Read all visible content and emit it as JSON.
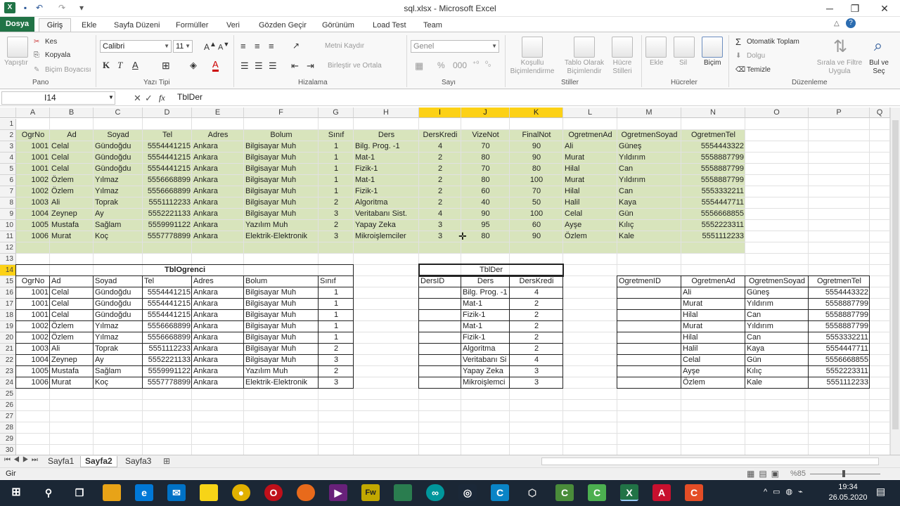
{
  "window": {
    "title": "sql.xlsx - Microsoft Excel",
    "minimize": "─",
    "restore": "❐",
    "close": "✕"
  },
  "tabs": {
    "file": "Dosya",
    "home": "Giriş",
    "items": [
      "Ekle",
      "Sayfa Düzeni",
      "Formüller",
      "Veri",
      "Gözden Geçir",
      "Görünüm",
      "Load Test",
      "Team"
    ]
  },
  "ribbon": {
    "clipboard": {
      "paste": "Yapıştır",
      "cut": "Kes",
      "copy": "Kopyala",
      "format_painter": "Biçim Boyacısı",
      "label": "Pano"
    },
    "font": {
      "name": "Calibri",
      "size": "11",
      "label": "Yazı Tipi",
      "bold": "K",
      "italic": "T",
      "underline": "A"
    },
    "alignment": {
      "wrap": "Metni Kaydır",
      "merge": "Birleştir ve Ortala",
      "label": "Hizalama"
    },
    "number": {
      "format": "Genel",
      "percent": "%",
      "label": "Sayı"
    },
    "styles": {
      "conditional": "Koşullu Biçimlendirme",
      "table": "Tablo Olarak Biçimlendir",
      "cell": "Hücre Stilleri",
      "label": "Stiller"
    },
    "cells": {
      "insert": "Ekle",
      "delete": "Sil",
      "format": "Biçim",
      "label": "Hücreler"
    },
    "editing": {
      "autosum": "Otomatik Toplam",
      "fill": "Dolgu",
      "clear": "Temizle",
      "sort": "Sırala ve Filtre Uygula",
      "find": "Bul ve Seç",
      "label": "Düzenleme"
    }
  },
  "formula_bar": {
    "name_box": "I14",
    "content": "TblDer",
    "fx": "fx"
  },
  "columns": [
    "A",
    "B",
    "C",
    "D",
    "E",
    "F",
    "G",
    "H",
    "I",
    "J",
    "K",
    "L",
    "M",
    "N",
    "O",
    "P",
    "Q"
  ],
  "rows": [
    "1",
    "2",
    "3",
    "4",
    "5",
    "6",
    "7",
    "8",
    "9",
    "10",
    "11",
    "12",
    "13",
    "14",
    "15",
    "16",
    "17",
    "18",
    "19",
    "20",
    "21",
    "22",
    "23",
    "24",
    "25",
    "26",
    "27",
    "28",
    "29",
    "30"
  ],
  "main_table": {
    "headers": [
      "OgrNo",
      "Ad",
      "Soyad",
      "Tel",
      "Adres",
      "Bolum",
      "Sınıf",
      "Ders",
      "DersKredi",
      "VizeNot",
      "FinalNot",
      "OgretmenAd",
      "OgretmenSoyad",
      "OgretmenTel"
    ],
    "rows": [
      [
        "1001",
        "Celal",
        "Gündoğdu",
        "5554441215",
        "Ankara",
        "Bilgisayar Muh",
        "1",
        "Bilg. Prog. -1",
        "4",
        "70",
        "90",
        "Ali",
        "Güneş",
        "5554443322"
      ],
      [
        "1001",
        "Celal",
        "Gündoğdu",
        "5554441215",
        "Ankara",
        "Bilgisayar Muh",
        "1",
        "Mat-1",
        "2",
        "80",
        "90",
        "Murat",
        "Yıldırım",
        "5558887799"
      ],
      [
        "1001",
        "Celal",
        "Gündoğdu",
        "5554441215",
        "Ankara",
        "Bilgisayar Muh",
        "1",
        "Fizik-1",
        "2",
        "70",
        "80",
        "Hilal",
        "Can",
        "5558887799"
      ],
      [
        "1002",
        "Özlem",
        "Yılmaz",
        "5556668899",
        "Ankara",
        "Bilgisayar Muh",
        "1",
        "Mat-1",
        "2",
        "80",
        "100",
        "Murat",
        "Yıldırım",
        "5558887799"
      ],
      [
        "1002",
        "Özlem",
        "Yılmaz",
        "5556668899",
        "Ankara",
        "Bilgisayar Muh",
        "1",
        "Fizik-1",
        "2",
        "60",
        "70",
        "Hilal",
        "Can",
        "5553332211"
      ],
      [
        "1003",
        "Ali",
        "Toprak",
        "5551112233",
        "Ankara",
        "Bilgisayar Muh",
        "2",
        "Algoritma",
        "2",
        "40",
        "50",
        "Halil",
        "Kaya",
        "5554447711"
      ],
      [
        "1004",
        "Zeynep",
        "Ay",
        "5552221133",
        "Ankara",
        "Bilgisayar Muh",
        "3",
        "Veritabanı Sist.",
        "4",
        "90",
        "100",
        "Celal",
        "Gün",
        "5556668855"
      ],
      [
        "1005",
        "Mustafa",
        "Sağlam",
        "5559991122",
        "Ankara",
        "Yazılım Muh",
        "2",
        "Yapay Zeka",
        "3",
        "95",
        "60",
        "Ayşe",
        "Kılıç",
        "5552223311"
      ],
      [
        "1006",
        "Murat",
        "Koç",
        "5557778899",
        "Ankara",
        "Elektrik-Elektronik",
        "3",
        "Mikroişlemciler",
        "3",
        "80",
        "90",
        "Özlem",
        "Kale",
        "5551112233"
      ]
    ]
  },
  "tbl_ogrenci": {
    "title": "TblOgrenci",
    "headers": [
      "OgrNo",
      "Ad",
      "Soyad",
      "Tel",
      "Adres",
      "Bolum",
      "Sınıf"
    ],
    "rows": [
      [
        "1001",
        "Celal",
        "Gündoğdu",
        "5554441215",
        "Ankara",
        "Bilgisayar Muh",
        "1"
      ],
      [
        "1001",
        "Celal",
        "Gündoğdu",
        "5554441215",
        "Ankara",
        "Bilgisayar Muh",
        "1"
      ],
      [
        "1001",
        "Celal",
        "Gündoğdu",
        "5554441215",
        "Ankara",
        "Bilgisayar Muh",
        "1"
      ],
      [
        "1002",
        "Özlem",
        "Yılmaz",
        "5556668899",
        "Ankara",
        "Bilgisayar Muh",
        "1"
      ],
      [
        "1002",
        "Özlem",
        "Yılmaz",
        "5556668899",
        "Ankara",
        "Bilgisayar Muh",
        "1"
      ],
      [
        "1003",
        "Ali",
        "Toprak",
        "5551112233",
        "Ankara",
        "Bilgisayar Muh",
        "2"
      ],
      [
        "1004",
        "Zeynep",
        "Ay",
        "5552221133",
        "Ankara",
        "Bilgisayar Muh",
        "3"
      ],
      [
        "1005",
        "Mustafa",
        "Sağlam",
        "5559991122",
        "Ankara",
        "Yazılım Muh",
        "2"
      ],
      [
        "1006",
        "Murat",
        "Koç",
        "5557778899",
        "Ankara",
        "Elektrik-Elektronik",
        "3"
      ]
    ]
  },
  "tbl_der": {
    "title": "TblDer",
    "headers": [
      "DersID",
      "Ders",
      "DersKredi"
    ],
    "rows": [
      [
        "",
        "Bilg. Prog. -1",
        "4"
      ],
      [
        "",
        "Mat-1",
        "2"
      ],
      [
        "",
        "Fizik-1",
        "2"
      ],
      [
        "",
        "Mat-1",
        "2"
      ],
      [
        "",
        "Fizik-1",
        "2"
      ],
      [
        "",
        "Algoritma",
        "2"
      ],
      [
        "",
        "Veritabanı Si",
        "4"
      ],
      [
        "",
        "Yapay Zeka",
        "3"
      ],
      [
        "",
        "Mikroişlemci",
        "3"
      ]
    ]
  },
  "tbl_ogretmen": {
    "headers": [
      "OgretmenID",
      "OgretmenAd",
      "OgretmenSoyad",
      "OgretmenTel"
    ],
    "rows": [
      [
        "",
        "Ali",
        "Güneş",
        "5554443322"
      ],
      [
        "",
        "Murat",
        "Yıldırım",
        "5558887799"
      ],
      [
        "",
        "Hilal",
        "Can",
        "5558887799"
      ],
      [
        "",
        "Murat",
        "Yıldırım",
        "5558887799"
      ],
      [
        "",
        "Hilal",
        "Can",
        "5553332211"
      ],
      [
        "",
        "Halil",
        "Kaya",
        "5554447711"
      ],
      [
        "",
        "Celal",
        "Gün",
        "5556668855"
      ],
      [
        "",
        "Ayşe",
        "Kılıç",
        "5552223311"
      ],
      [
        "",
        "Özlem",
        "Kale",
        "5551112233"
      ]
    ]
  },
  "sheets": [
    "Sayfa1",
    "Sayfa2",
    "Sayfa3"
  ],
  "active_sheet": "Sayfa2",
  "status": {
    "mode": "Gir",
    "zoom": "%85"
  },
  "taskbar": {
    "time": "19:34",
    "date": "26.05.2020"
  },
  "colors": {
    "excel_green": "#217346",
    "header_selected": "#fcd116",
    "table_fill": "#d8e4bc"
  }
}
